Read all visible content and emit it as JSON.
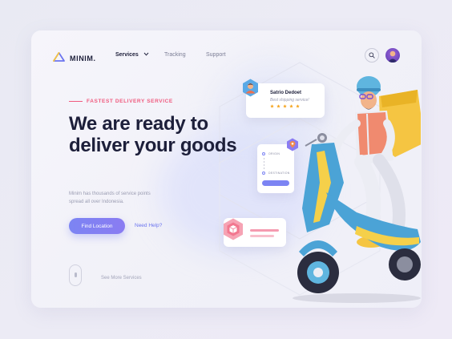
{
  "nav": {
    "brand": "MINIM.",
    "services": "Services",
    "tracking": "Tracking",
    "support": "Support"
  },
  "hero": {
    "eyebrow": "FASTEST DELIVERY SERVICE",
    "headline": "We are ready to deliver your goods",
    "subtext": "Minim has thousands of service points spread all over Indonesia.",
    "primary_cta": "Find Location",
    "secondary_cta": "Need Help?",
    "scroll_hint": "See More Services"
  },
  "courier_card": {
    "name": "Satrio Dedoet",
    "role": "Best shipping service!",
    "rating": 5
  },
  "route_card": {
    "origin_label": "ORIGIN",
    "destination_label": "DESTINATION"
  },
  "icons": {
    "logo": "triangle-logo-icon",
    "chevron": "chevron-down-icon",
    "search": "search-icon",
    "scroll": "mouse-scroll-icon",
    "pin": "location-pin-icon",
    "package": "package-icon",
    "star": "star-icon"
  },
  "colors": {
    "accent": "#7c84f3",
    "pink": "#f05a7e",
    "heading": "#1d1f3a",
    "star": "#f5a623"
  }
}
